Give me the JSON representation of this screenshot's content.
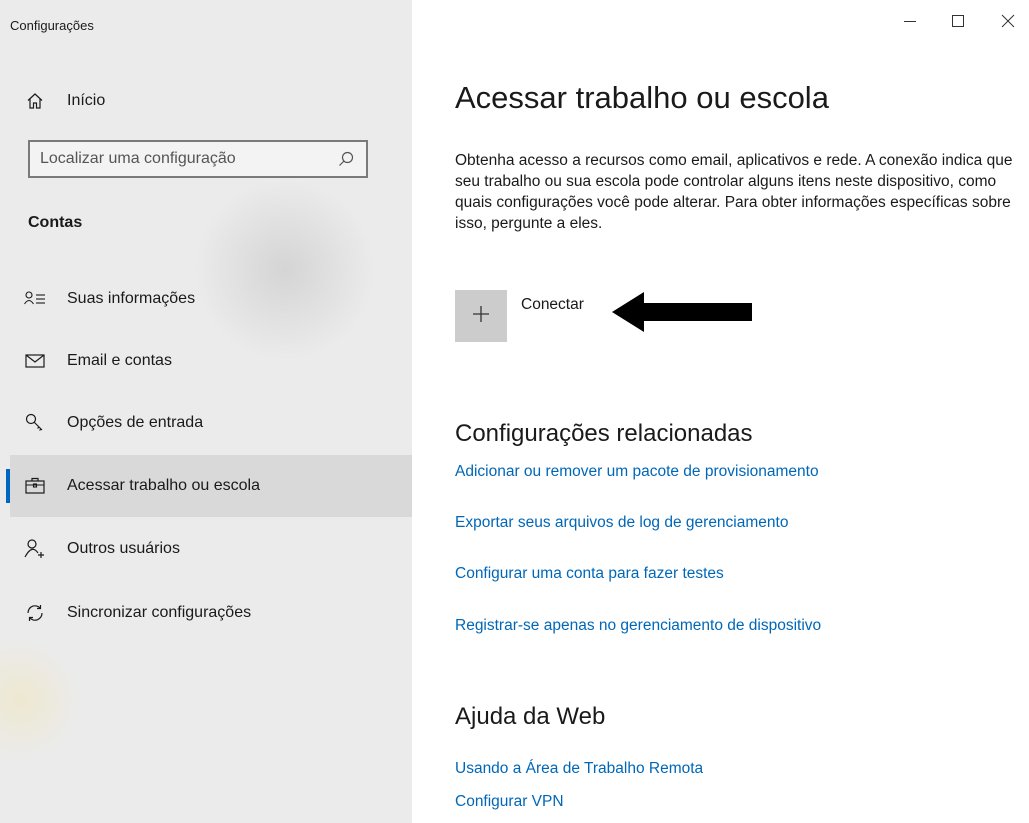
{
  "window": {
    "title": "Configurações",
    "controls": [
      "minimize-icon",
      "maximize-icon",
      "close-icon"
    ]
  },
  "sidebar": {
    "home_label": "Início",
    "search_placeholder": "Localizar uma configuração",
    "section_heading": "Contas",
    "items": [
      {
        "label": "Suas informações",
        "icon": "person-info-icon",
        "active": false
      },
      {
        "label": "Email e contas",
        "icon": "mail-icon",
        "active": false
      },
      {
        "label": "Opções de entrada",
        "icon": "key-icon",
        "active": false
      },
      {
        "label": "Acessar trabalho ou escola",
        "icon": "briefcase-icon",
        "active": true
      },
      {
        "label": "Outros usuários",
        "icon": "add-person-icon",
        "active": false
      },
      {
        "label": "Sincronizar configurações",
        "icon": "sync-icon",
        "active": false
      }
    ]
  },
  "main": {
    "title": "Acessar trabalho ou escola",
    "description": "Obtenha acesso a recursos como email, aplicativos e rede. A conexão indica que seu trabalho ou sua escola pode controlar alguns itens neste dispositivo, como quais configurações você pode alterar. Para obter informações específicas sobre isso, pergunte a eles.",
    "connect_label": "Conectar",
    "related": {
      "heading": "Configurações relacionadas",
      "links": [
        "Adicionar ou remover um pacote de provisionamento",
        "Exportar seus arquivos de log de gerenciamento",
        "Configurar uma conta para fazer testes",
        "Registrar-se apenas no gerenciamento de dispositivo"
      ]
    },
    "web_help": {
      "heading": "Ajuda da Web",
      "links": [
        "Usando a Área de Trabalho Remota",
        "Configurar VPN"
      ]
    }
  },
  "colors": {
    "accent": "#0067c0",
    "link": "#0067b8",
    "sidebar_bg": "#ebebeb",
    "active_item_bg": "#d9d9d9"
  }
}
